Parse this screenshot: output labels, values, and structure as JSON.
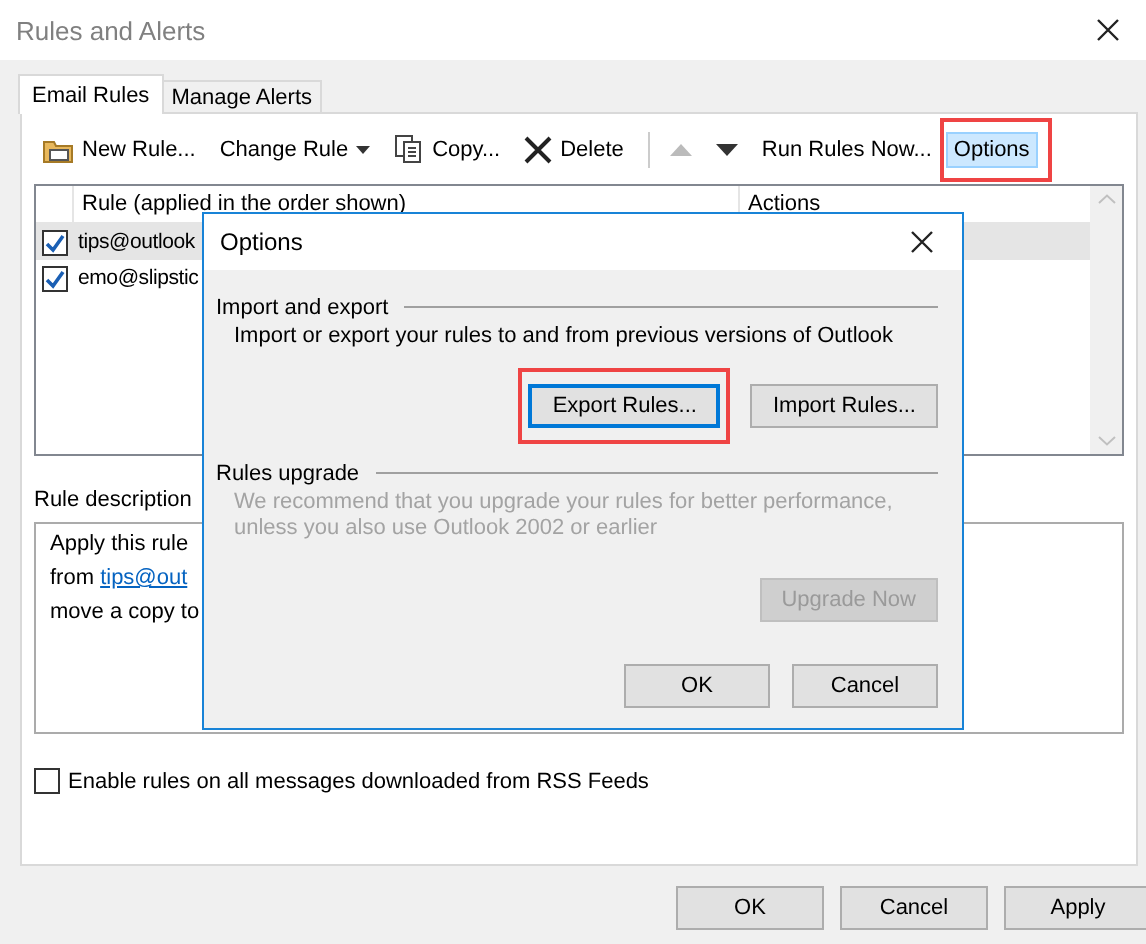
{
  "window": {
    "title": "Rules and Alerts"
  },
  "tabs": [
    {
      "label": "Email Rules",
      "selected": true
    },
    {
      "label": "Manage Alerts",
      "selected": false
    }
  ],
  "toolbar": [
    {
      "kind": "new",
      "label": "New Rule...",
      "disabled": false,
      "selected": false,
      "highlighted": false
    },
    {
      "kind": "menu",
      "label": "Change Rule",
      "disabled": false,
      "selected": false,
      "highlighted": false
    },
    {
      "kind": "copy",
      "label": "Copy...",
      "disabled": false,
      "selected": false,
      "highlighted": false
    },
    {
      "kind": "delete",
      "label": "Delete",
      "disabled": false,
      "selected": false,
      "highlighted": false
    },
    {
      "kind": "up",
      "disabled": true,
      "selected": false,
      "highlighted": false
    },
    {
      "kind": "down",
      "disabled": false,
      "selected": false,
      "highlighted": false
    },
    {
      "kind": "text",
      "label": "Run Rules Now...",
      "disabled": false,
      "selected": false,
      "highlighted": false
    },
    {
      "kind": "text",
      "label": "Options",
      "disabled": false,
      "selected": true,
      "highlighted": true
    }
  ],
  "rules": {
    "columns": [
      "Rule (applied in the order shown)",
      "Actions"
    ],
    "rows": [
      {
        "name": "tips@outlook",
        "checked": true,
        "selected": true
      },
      {
        "name": "emo@slipstic",
        "checked": true,
        "selected": false
      }
    ]
  },
  "description": {
    "label": "Rule description",
    "lines": [
      [
        {
          "text": "Apply this rule"
        }
      ],
      [
        {
          "text": "from "
        },
        {
          "text": "tips@out",
          "kind": "link"
        }
      ],
      [
        {
          "text": "move a copy to"
        }
      ]
    ]
  },
  "rss": {
    "label": "Enable rules on all messages downloaded from RSS Feeds",
    "checked": false
  },
  "buttons": [
    {
      "label": "OK"
    },
    {
      "label": "Cancel"
    },
    {
      "label": "Apply"
    }
  ],
  "dialog": {
    "title": "Options",
    "sections": [
      {
        "heading": "Import and export",
        "text": "Import or export your rules to and from previous versions of Outlook",
        "disabled": false,
        "buttons": [
          {
            "label": "Export Rules...",
            "default": true,
            "disabled": false,
            "highlighted": true
          },
          {
            "label": "Import Rules...",
            "default": false,
            "disabled": false,
            "highlighted": false
          }
        ]
      },
      {
        "heading": "Rules upgrade",
        "text": "We recommend that you upgrade your rules for better performance, unless you also use Outlook 2002 or earlier",
        "disabled": true,
        "buttons": [
          {
            "label": "Upgrade Now",
            "default": false,
            "disabled": true,
            "highlighted": false
          }
        ]
      }
    ],
    "buttons": [
      {
        "label": "OK"
      },
      {
        "label": "Cancel"
      }
    ]
  }
}
